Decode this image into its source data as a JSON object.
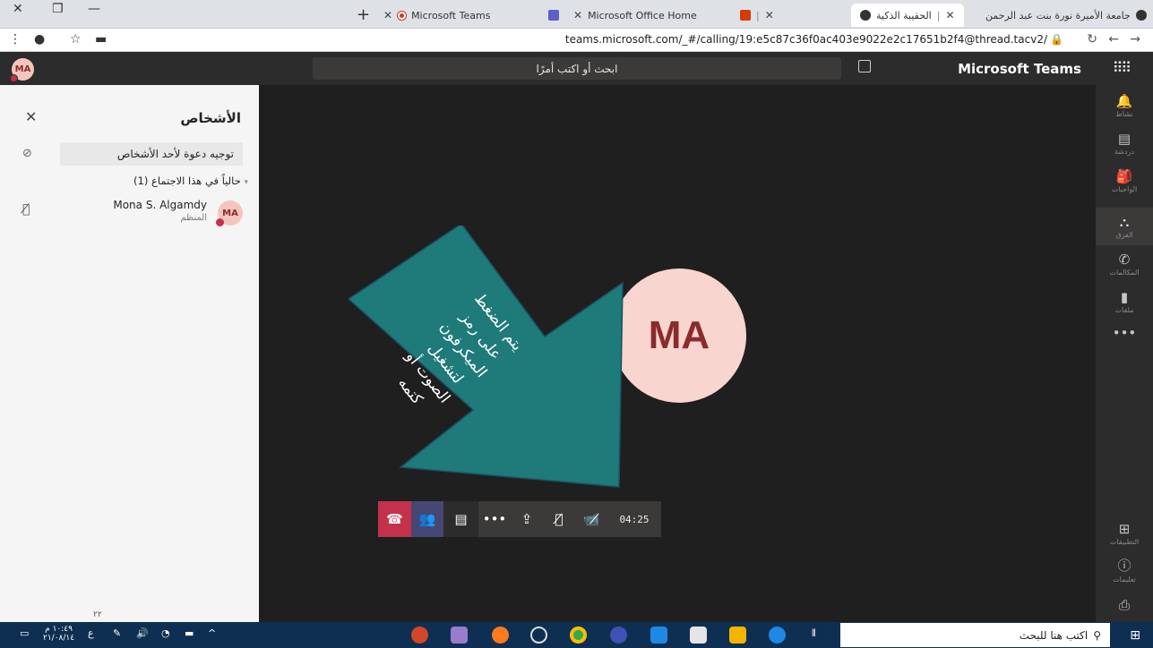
{
  "browser": {
    "tabs": [
      {
        "title": "جامعة الأميرة نورة بنت عبد الرحمن"
      },
      {
        "title": "الحقيبة الذكية"
      },
      {
        "title": "Microsoft Office Home"
      },
      {
        "title": "Microsoft Teams"
      }
    ],
    "url": "teams.microsoft.com/_#/calling/19:e5c87c36f0ac403e9022e2c17651b2f4@thread.tacv2/"
  },
  "header": {
    "user_initials": "MA",
    "search_placeholder": "ابحث أو اكتب أمرًا",
    "app_title": "Microsoft Teams"
  },
  "rail": {
    "items": [
      {
        "label": "نشاط",
        "icon": "bell-icon"
      },
      {
        "label": "دردشة",
        "icon": "chat-icon"
      },
      {
        "label": "الواجبات",
        "icon": "assignments-icon"
      },
      {
        "label": "الفرق",
        "icon": "teams-icon"
      },
      {
        "label": "المكالمات",
        "icon": "phone-icon"
      },
      {
        "label": "ملفات",
        "icon": "file-icon"
      },
      {
        "label": "التطبيقات",
        "icon": "apps-icon"
      },
      {
        "label": "تعليمات",
        "icon": "help-icon"
      }
    ]
  },
  "people_pane": {
    "title": "الأشخاص",
    "invite_label": "توجيه دعوة لأحد الأشخاص",
    "section_label": "حالياً في هذا الاجتماع (1)",
    "participant": {
      "name": "Mona S. Algamdy",
      "role": "المنظم",
      "initials": "MA"
    },
    "footer_number": "٢٢"
  },
  "stage": {
    "avatar_initials": "MA",
    "annotation_text": [
      "يتم الضغط",
      "على رمز",
      "الميكرفون",
      "لتشغيل",
      "الصوت أو",
      "كتمه"
    ],
    "annotation_color": "#1f7a7a"
  },
  "callbar": {
    "timer": "04:25"
  },
  "taskbar": {
    "search_placeholder": "اكتب هنا للبحث",
    "time": "١٠:٤٩ م",
    "date": "٢١/٠٨/١٤",
    "lang": "ع"
  }
}
